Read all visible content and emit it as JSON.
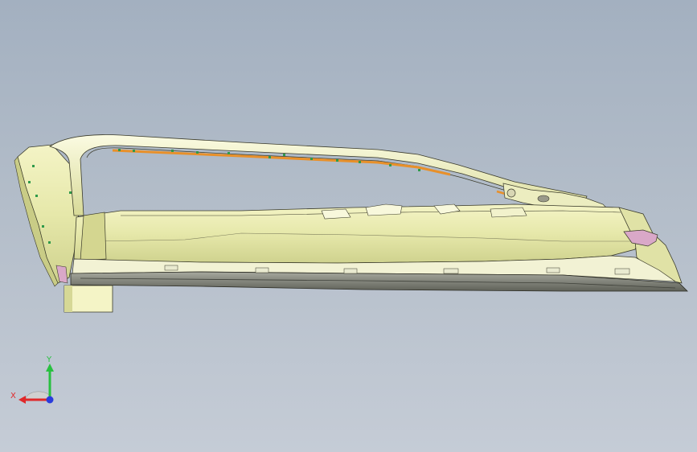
{
  "viewport": {
    "background_top": "#a3b0c0",
    "background_bottom": "#c5ccd6",
    "model": {
      "part_color_light": "#f6f6cc",
      "part_color_mid": "#e4e6a8",
      "part_color_shadow": "#c9cc86",
      "edge_color": "#3a3a2a",
      "seal_color": "#e8902a",
      "clip_color": "#2f9a4a",
      "accent_pink": "#d9a8c8",
      "base_dark": "#8c8f86"
    }
  },
  "triad": {
    "x_label": "X",
    "y_label": "Y",
    "x_color": "#e0282a",
    "y_color": "#28c040",
    "z_color": "#2a3cdc",
    "icon": "coordinate-triad-icon"
  }
}
